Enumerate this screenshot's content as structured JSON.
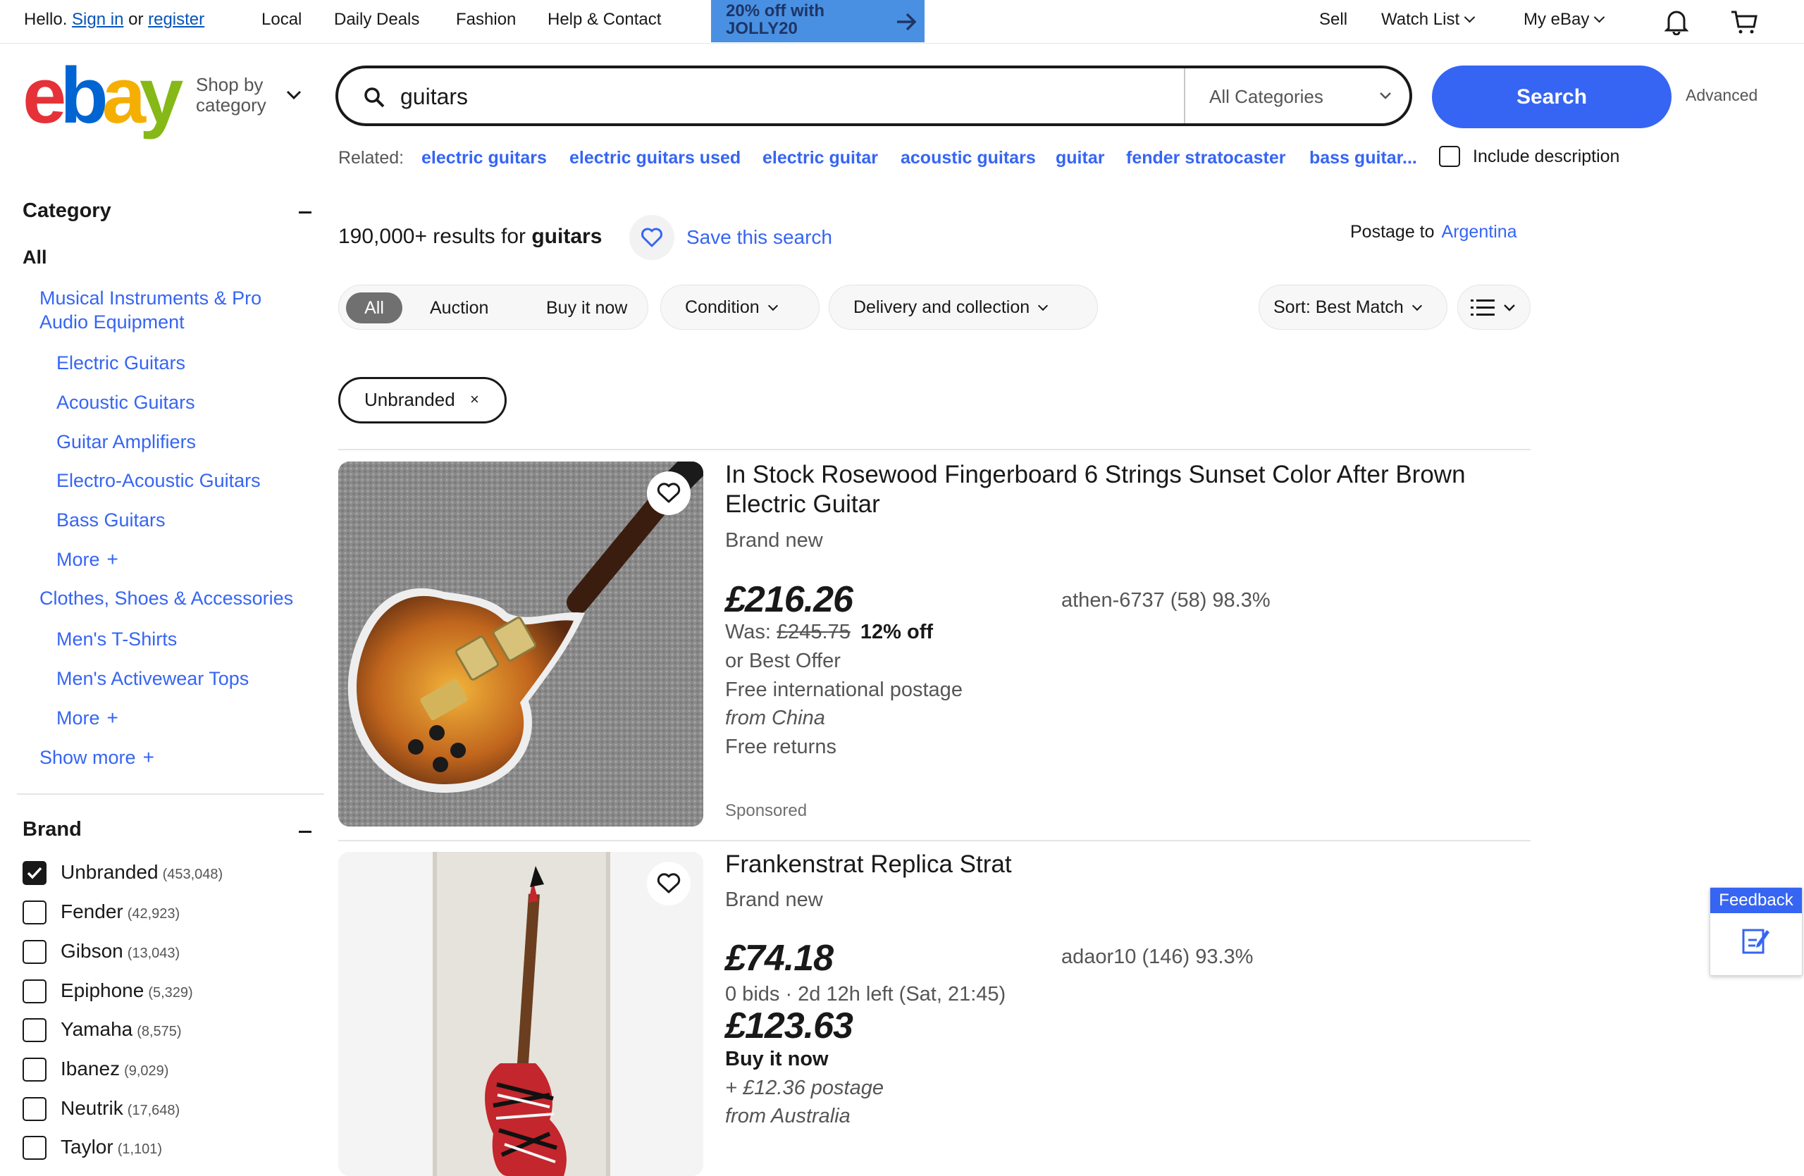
{
  "topnav": {
    "hello": "Hello.",
    "sign_in": "Sign in",
    "or": "or",
    "register": "register",
    "local": "Local",
    "daily_deals": "Daily Deals",
    "fashion": "Fashion",
    "help": "Help & Contact",
    "banner_text": "20% off with\nJOLLY20",
    "sell": "Sell",
    "watch_list": "Watch List",
    "my_ebay": "My eBay"
  },
  "header": {
    "logo": {
      "e": "e",
      "b": "b",
      "a": "a",
      "y": "y"
    },
    "shop_by_category": "Shop by\ncategory",
    "search_query": "guitars",
    "category_select": "All Categories",
    "search_button": "Search",
    "advanced": "Advanced"
  },
  "related": {
    "label": "Related:",
    "links": [
      "electric guitars",
      "electric guitars used",
      "electric guitar",
      "acoustic guitars",
      "guitar",
      "fender stratocaster",
      "bass guitar..."
    ],
    "include_description": "Include description"
  },
  "sidebar": {
    "category_heading": "Category",
    "all": "All",
    "items": [
      "Musical Instruments & Pro\nAudio Equipment",
      "Electric Guitars",
      "Acoustic Guitars",
      "Guitar Amplifiers",
      "Electro-Acoustic Guitars",
      "Bass Guitars",
      "More",
      "Clothes, Shoes & Accessories",
      "Men's T-Shirts",
      "Men's Activewear Tops",
      "More",
      "Show more"
    ],
    "brand_heading": "Brand",
    "brands": [
      {
        "name": "Unbranded",
        "count": "(453,048)",
        "checked": true
      },
      {
        "name": "Fender",
        "count": "(42,923)",
        "checked": false
      },
      {
        "name": "Gibson",
        "count": "(13,043)",
        "checked": false
      },
      {
        "name": "Epiphone",
        "count": "(5,329)",
        "checked": false
      },
      {
        "name": "Yamaha",
        "count": "(8,575)",
        "checked": false
      },
      {
        "name": "Ibanez",
        "count": "(9,029)",
        "checked": false
      },
      {
        "name": "Neutrik",
        "count": "(17,648)",
        "checked": false
      },
      {
        "name": "Taylor",
        "count": "(1,101)",
        "checked": false
      }
    ]
  },
  "results": {
    "count_text": "190,000+ results for",
    "query": "guitars",
    "save_search": "Save this search",
    "postage_to": "Postage to",
    "country": "Argentina",
    "filters": {
      "all": "All",
      "auction": "Auction",
      "buy_it_now": "Buy it now",
      "condition": "Condition",
      "delivery": "Delivery and collection",
      "sort": "Sort: Best Match"
    },
    "chip": "Unbranded",
    "chip_close": "×"
  },
  "listings": [
    {
      "title": "In Stock Rosewood Fingerboard 6 Strings Sunset Color After Brown Electric Guitar",
      "condition": "Brand new",
      "price": "£216.26",
      "was_label": "Was:",
      "was_price": "£245.75",
      "discount": "12% off",
      "best_offer": "or Best Offer",
      "shipping": "Free international postage",
      "from": "from China",
      "returns": "Free returns",
      "sponsored": "Sponsored",
      "seller": "athen-6737 (58) 98.3%"
    },
    {
      "title": "Frankenstrat Replica Strat",
      "condition": "Brand new",
      "price": "£74.18",
      "bids": "0 bids · 2d 12h left (Sat, 21:45)",
      "bin_price": "£123.63",
      "bin_label": "Buy it now",
      "shipping": "+ £12.36 postage",
      "from": "from Australia",
      "seller": "adaor10 (146) 93.3%"
    }
  ],
  "feedback": "Feedback",
  "colors": {
    "accent": "#3665f3",
    "logo_e": "#e53238",
    "logo_b": "#0064d2",
    "logo_a": "#f5af02",
    "logo_y": "#86b817",
    "banner": "#4a90e2"
  }
}
